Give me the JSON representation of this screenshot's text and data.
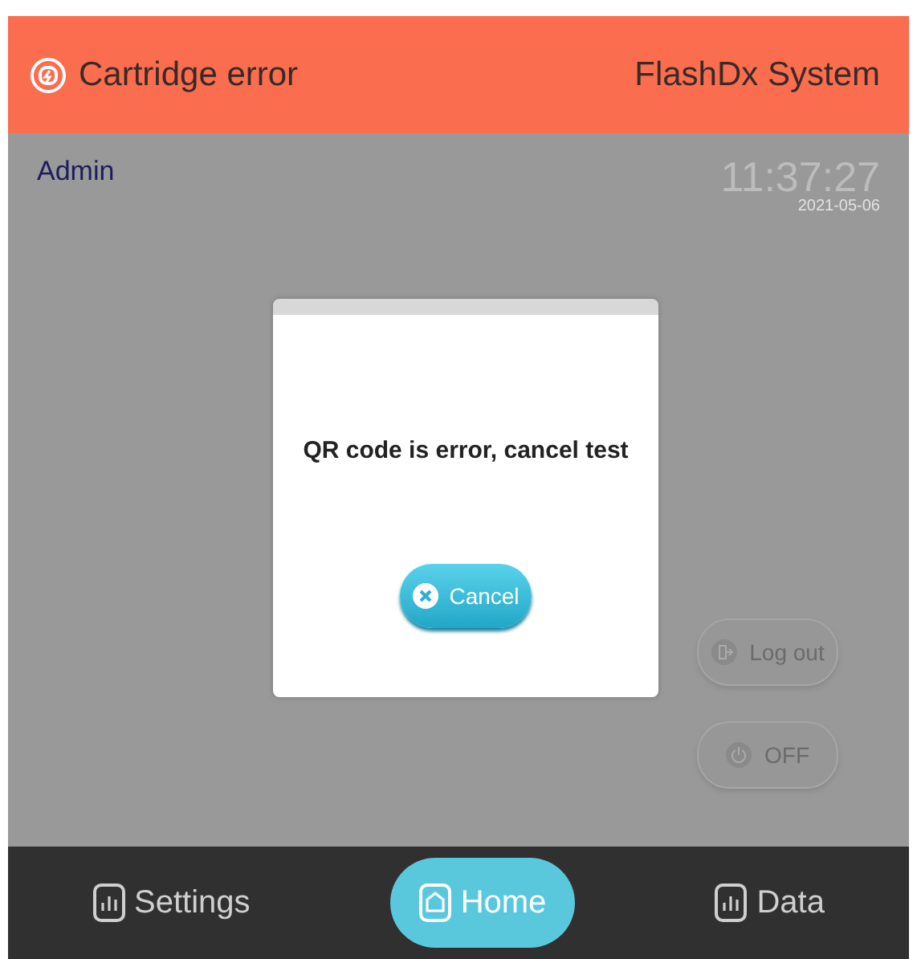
{
  "header": {
    "status": "Cartridge error",
    "system": "FlashDx System"
  },
  "user": "Admin",
  "clock": {
    "time": "11:37:27",
    "date": "2021-05-06"
  },
  "side_buttons": [
    {
      "kind": "logout",
      "label": "Log out"
    },
    {
      "kind": "power",
      "label": "OFF"
    }
  ],
  "dialog": {
    "message": "QR code is error, cancel test",
    "button": "Cancel"
  },
  "nav": [
    {
      "kind": "settings",
      "label": "Settings",
      "selected": false
    },
    {
      "kind": "home",
      "label": "Home",
      "selected": true
    },
    {
      "kind": "data",
      "label": "Data",
      "selected": false
    }
  ]
}
